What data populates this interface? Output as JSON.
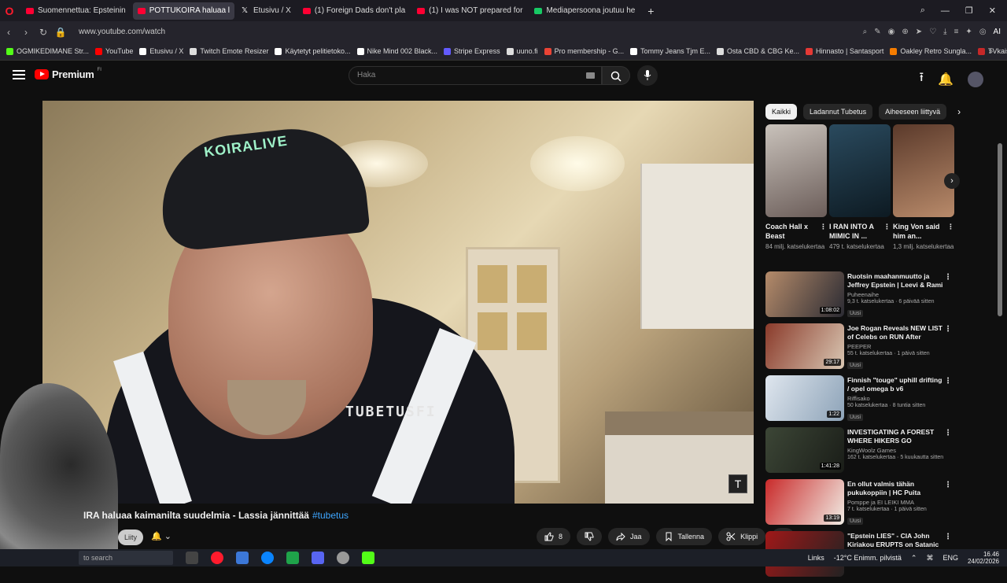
{
  "browser": {
    "tabs": [
      {
        "label": "Suomennettua: Epsteinin",
        "favicon": "youtube",
        "active": false
      },
      {
        "label": "POTTUKOIRA haluaa l",
        "favicon": "youtube",
        "active": true
      },
      {
        "label": "Etusivu / X",
        "favicon": "x",
        "active": false
      },
      {
        "label": "(1) Foreign Dads don't pla",
        "favicon": "youtube",
        "active": false
      },
      {
        "label": "(1) I was NOT prepared for",
        "favicon": "youtube",
        "active": false
      },
      {
        "label": "Mediapersoona joutuu he",
        "favicon": "generic",
        "active": false
      }
    ],
    "url": "www.youtube.com/watch",
    "ai_label": "AI",
    "bookmarks": [
      {
        "label": "OGMIKEDIMANE Str...",
        "color": "#53fc18"
      },
      {
        "label": "YouTube",
        "color": "#ff0000"
      },
      {
        "label": "Etusivu / X",
        "color": "#ffffff"
      },
      {
        "label": "Twitch Emote Resizer",
        "color": "#dddddd"
      },
      {
        "label": "Käytetyt pelitietoko...",
        "color": "#ffffff"
      },
      {
        "label": "Nike Mind 002 Black...",
        "color": "#ffffff"
      },
      {
        "label": "Stripe Express",
        "color": "#635bff"
      },
      {
        "label": "uuno.fi",
        "color": "#dddddd"
      },
      {
        "label": "Pro membership - G...",
        "color": "#ea4335"
      },
      {
        "label": "Tommy Jeans Tjm E...",
        "color": "#ffffff"
      },
      {
        "label": "Osta CBD & CBG Ke...",
        "color": "#dddddd"
      },
      {
        "label": "Hinnasto | Santasport",
        "color": "#e53935"
      },
      {
        "label": "Oakley Retro Sungla...",
        "color": "#f57c00"
      },
      {
        "label": "TVkaista - Sub Suora",
        "color": "#c62828"
      }
    ]
  },
  "youtube": {
    "logo_text": "Premium",
    "logo_sup": "FI",
    "search_placeholder": "Haka",
    "video": {
      "cap_text": "KOIRALIVE",
      "watermark": "TUBETUSFI",
      "title": "IRA haluaa kaimanilta suudelmia - Lassia jännittää",
      "hashtag": "#tubetus",
      "likes": "8",
      "share": "Jaa",
      "save": "Tallenna",
      "clip": "Klippi",
      "join": "Liity"
    },
    "chips": [
      {
        "label": "Kaikki",
        "active": true
      },
      {
        "label": "Ladannut Tubetus",
        "active": false
      },
      {
        "label": "Aiheeseen liittyvä",
        "active": false
      }
    ],
    "shorts": [
      {
        "title": "Coach Hall x Beast",
        "views": "84 milj. katselukertaa",
        "c1": "#c9c2bb",
        "c2": "#6b5d59"
      },
      {
        "title": "I RAN INTO A MIMIC IN ...",
        "views": "479 t. katselukertaa",
        "c1": "#2a4a5e",
        "c2": "#0d1a22"
      },
      {
        "title": "King Von said him an...",
        "views": "1,3 milj. katselukertaa",
        "c1": "#5b3a2b",
        "c2": "#b88a6a"
      }
    ],
    "recs": [
      {
        "title": "Ruotsin maahanmuutto ja Jeffrey Epstein | Leevi & Rami ...",
        "channel": "Puheenaihe",
        "meta": "9,3 t. katselukertaa · 6 päivää sitten",
        "badge": "Uusi",
        "duration": "1:08:02",
        "c1": "#b58b6a",
        "c2": "#2b2b33"
      },
      {
        "title": "Joe Rogan Reveals NEW LIST of Celebs on RUN After Epstein",
        "channel": "PEEPER",
        "meta": "55 t. katselukertaa · 1 päivä sitten",
        "badge": "Uusi",
        "duration": "29:17",
        "c1": "#8a3a2a",
        "c2": "#d9c7b3"
      },
      {
        "title": "Finnish \"touge\" uphill drifting / opel omega b v6",
        "channel": "Riffisako",
        "meta": "50 katselukertaa · 8 tuntia sitten",
        "badge": "Uusi",
        "duration": "1:22",
        "c1": "#dfe6ee",
        "c2": "#8da3b8"
      },
      {
        "title": "INVESTIGATING A FOREST WHERE HIKERS GO MISSING...",
        "channel": "KingWoolz Games",
        "meta": "162 t. katselukertaa · 5 kuukautta sitten",
        "badge": "",
        "duration": "1:41:28",
        "c1": "#3c4636",
        "c2": "#1a1d18"
      },
      {
        "title": "En ollut valmis tähän pukukoppiin | HC Puita",
        "channel": "Pomppe ja EI LEIKI MMA",
        "meta": "7 t. katselukertaa · 1 päivä sitten",
        "badge": "Uusi",
        "duration": "13:19",
        "c1": "#c92a2a",
        "c2": "#f1ece4"
      },
      {
        "title": "\"Epstein LIES\" - CIA John Kiriakou ERUPTS on Satanic ...",
        "channel": "",
        "meta": "",
        "badge": "",
        "duration": "",
        "c1": "#a01818",
        "c2": "#222222"
      }
    ]
  },
  "taskbar": {
    "search": "to search",
    "links": "Links",
    "weather": "-12°C  Enimm. pilvistä",
    "lang": "ENG",
    "time": "16.46",
    "date": "24/02/2026"
  }
}
